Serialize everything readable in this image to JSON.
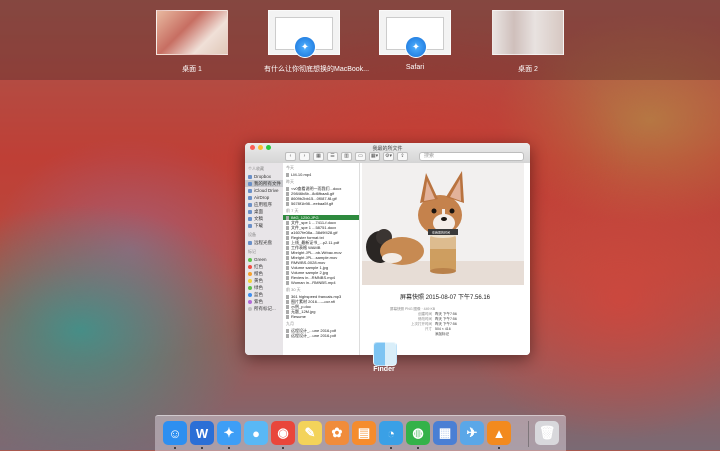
{
  "mission_control": {
    "spaces": [
      {
        "label": "桌面 1"
      },
      {
        "label": "有什么让你彻底想换的MacBook..."
      },
      {
        "label": "Safari"
      },
      {
        "label": "桌面 2"
      }
    ]
  },
  "finder_window": {
    "title": "我最的所文件",
    "search_placeholder": "搜索",
    "toolbar": {
      "back": "‹",
      "forward": "›",
      "view_icon": "▦",
      "view_list": "☰",
      "view_column": "▥",
      "view_cover": "▭",
      "arrange": "▦▾",
      "action": "⚙▾",
      "share": "⇪"
    },
    "sidebar": {
      "favorites_heading": "个人收藏",
      "items": [
        "Dropbox",
        "我的所有文件",
        "iCloud Drive",
        "AirDrop",
        "应用程序",
        "桌面",
        "文稿",
        "下载"
      ],
      "devices_heading": "设备",
      "device_items": [
        "远程光盘"
      ],
      "tags_heading": "标记",
      "tags": [
        {
          "label": "Green",
          "color": "#5dbf4b"
        },
        {
          "label": "红色",
          "color": "#ef4d43"
        },
        {
          "label": "橙色",
          "color": "#f6a02d"
        },
        {
          "label": "黄色",
          "color": "#f3d33b"
        },
        {
          "label": "绿色",
          "color": "#5dbf4b"
        },
        {
          "label": "蓝色",
          "color": "#3d8ef0"
        },
        {
          "label": "紫色",
          "color": "#b26ad6"
        },
        {
          "label": "所有标记...",
          "color": "#c0c0c0"
        }
      ]
    },
    "file_sections": [
      {
        "heading": "今天",
        "items": [
          "LM-10.mp4"
        ]
      },
      {
        "heading": "昨天",
        "items": [
          "<v0查看说明一而我们...docx",
          "29846b8b...8d6fbaa6.gif",
          "8609b2bb15...0f087-f8.gif",
          "5678f1b98...eebaa5f.gif"
        ]
      },
      {
        "heading": "前 7 天",
        "items": [
          "IMG_1250.JPG",
          "文件_spe 1 ...7411-f.docx",
          "文件_spe 1 ...58751.docx",
          "a1607fe08a...38d9f428.gif",
          "Register format.txt",
          "上线_最新证书_...p2.11.pdf",
          "工作表格 WAMB",
          "Mbright JPL...nb-Wrbac.mov",
          "Mbright JPL...sample.mov",
          "RMWBS-0028.mov",
          "Volume sample 1.jpg",
          "Volume sample 2.jpg",
          "Review in...RMNBS.mp4",
          "Woman in...RMNBS.mp4"
        ]
      },
      {
        "heading": "前 30 天",
        "items": [
          "361 highspeed francais.mp3",
          "图片素材 2016...—ocr.nfi",
          "示例_p.doc",
          "无题_12M.jpg",
          "Resume"
        ]
      },
      {
        "heading": "九月",
        "items": [
          "远程设计_...une 2016.pdf",
          "远程设计_...une 2016.pdf"
        ]
      }
    ],
    "selected_file": "IMG_1250.JPG",
    "preview": {
      "photo_caption": "在我思的时间",
      "title": "屏幕快照 2015-08-07 下午7.56.16",
      "info": [
        {
          "key": "屏幕快照 PNG 图像 · 449 KB",
          "value": ""
        },
        {
          "key": "创建时间",
          "value": "昨天 下午7:56"
        },
        {
          "key": "修改时间",
          "value": "昨天 下午7:56"
        },
        {
          "key": "上次打开时间",
          "value": "昨天 下午7:56"
        },
        {
          "key": "尺寸",
          "value": "504 × 416"
        },
        {
          "key": "",
          "value": "添加标记"
        }
      ]
    }
  },
  "finder_app_label": "Finder",
  "dock": {
    "apps": [
      {
        "name": "finder-icon",
        "glyph": "☺",
        "color": "#2d8ff0",
        "running": true
      },
      {
        "name": "wps-icon",
        "glyph": "W",
        "color": "#2b6fd6",
        "running": true
      },
      {
        "name": "safari-icon",
        "glyph": "✦",
        "color": "#3d9ef6",
        "running": true
      },
      {
        "name": "messages-icon",
        "glyph": "●",
        "color": "#59b8f5",
        "running": false
      },
      {
        "name": "chrome-icon",
        "glyph": "◉",
        "color": "#e9463b",
        "running": true
      },
      {
        "name": "notes-icon",
        "glyph": "✎",
        "color": "#f3d35a",
        "running": false
      },
      {
        "name": "photos-icon",
        "glyph": "✿",
        "color": "#f08c3b",
        "running": false
      },
      {
        "name": "ibooks-icon",
        "glyph": "▤",
        "color": "#f58c2d",
        "running": false
      },
      {
        "name": "qq-icon",
        "glyph": "◔",
        "color": "#3aa0e6",
        "running": true
      },
      {
        "name": "wechat-icon",
        "glyph": "◍",
        "color": "#34b249",
        "running": true
      },
      {
        "name": "preview-icon",
        "glyph": "▦",
        "color": "#4a7fd4",
        "running": false
      },
      {
        "name": "paw-icon",
        "glyph": "✈",
        "color": "#5aa7e8",
        "running": false
      },
      {
        "name": "vlc-icon",
        "glyph": "▲",
        "color": "#f28a1e",
        "running": true
      },
      {
        "name": "trash-icon",
        "glyph": "🗑",
        "color": "#d8d8dc",
        "running": false
      }
    ]
  }
}
